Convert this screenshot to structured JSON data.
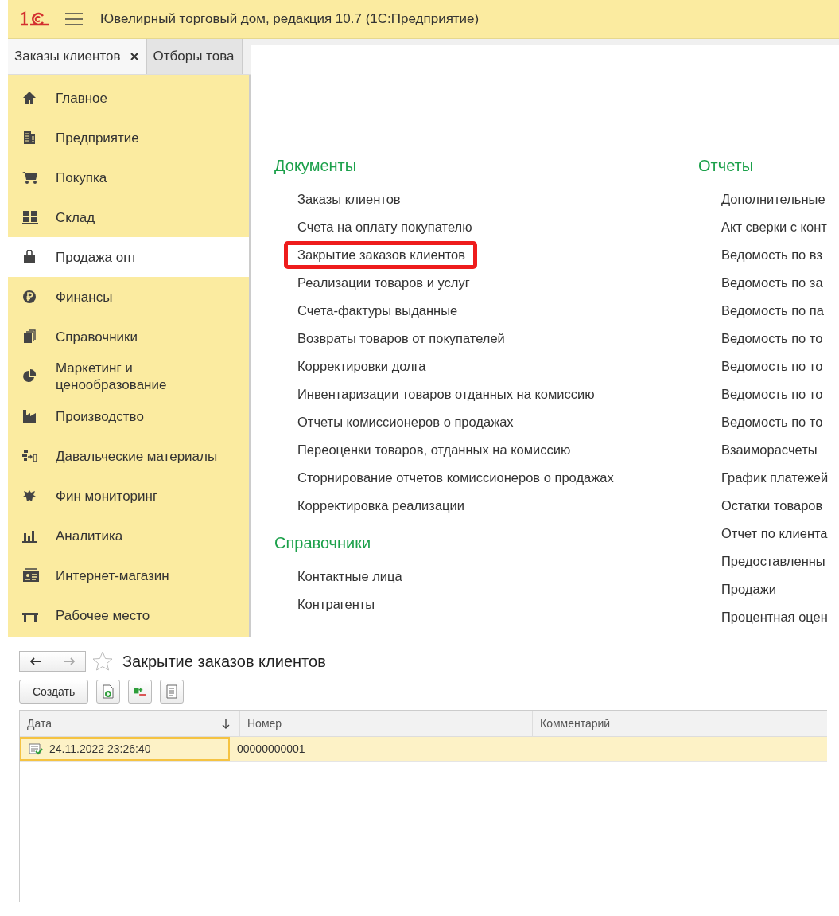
{
  "app_header": {
    "title": "Ювелирный торговый дом, редакция 10.7  (1С:Предприятие)"
  },
  "tabs": [
    {
      "label": "Заказы клиентов",
      "closable": true,
      "selected": true
    },
    {
      "label": "Отборы това",
      "closable": false,
      "selected": false
    }
  ],
  "sidebar": {
    "items": [
      {
        "label": "Главное",
        "selected": false
      },
      {
        "label": "Предприятие",
        "selected": false
      },
      {
        "label": "Покупка",
        "selected": false
      },
      {
        "label": "Склад",
        "selected": false
      },
      {
        "label": "Продажа опт",
        "selected": true
      },
      {
        "label": "Финансы",
        "selected": false
      },
      {
        "label": "Справочники",
        "selected": false
      },
      {
        "label": "Маркетинг и ценообразование",
        "selected": false
      },
      {
        "label": "Производство",
        "selected": false
      },
      {
        "label": "Давальческие материалы",
        "selected": false
      },
      {
        "label": "Фин мониторинг",
        "selected": false
      },
      {
        "label": "Аналитика",
        "selected": false
      },
      {
        "label": "Интернет-магазин",
        "selected": false
      },
      {
        "label": "Рабочее место",
        "selected": false
      }
    ]
  },
  "sections": [
    {
      "title": "Документы",
      "items": [
        {
          "label": "Заказы клиентов",
          "highlighted": false
        },
        {
          "label": "Счета на оплату покупателю",
          "highlighted": false
        },
        {
          "label": "Закрытие заказов клиентов",
          "highlighted": true
        },
        {
          "label": "Реализации товаров и услуг",
          "highlighted": false
        },
        {
          "label": "Счета-фактуры выданные",
          "highlighted": false
        },
        {
          "label": "Возвраты товаров от покупателей",
          "highlighted": false
        },
        {
          "label": "Корректировки долга",
          "highlighted": false
        },
        {
          "label": "Инвентаризации товаров отданных на комиссию",
          "highlighted": false
        },
        {
          "label": "Отчеты комиссионеров о продажах",
          "highlighted": false
        },
        {
          "label": "Переоценки товаров, отданных на комиссию",
          "highlighted": false
        },
        {
          "label": "Сторнирование отчетов комиссионеров о продажах",
          "highlighted": false
        },
        {
          "label": "Корректировка реализации",
          "highlighted": false
        }
      ]
    },
    {
      "title": "Справочники",
      "items": [
        {
          "label": "Контактные лица",
          "highlighted": false
        },
        {
          "label": "Контрагенты",
          "highlighted": false
        }
      ]
    },
    {
      "title": "Отчеты",
      "items": [
        {
          "label": "Дополнительные",
          "highlighted": false
        },
        {
          "label": "Акт сверки с конт",
          "highlighted": false
        },
        {
          "label": "Ведомость по вз",
          "highlighted": false
        },
        {
          "label": "Ведомость по за",
          "highlighted": false
        },
        {
          "label": "Ведомость по па",
          "highlighted": false
        },
        {
          "label": "Ведомость по то",
          "highlighted": false
        },
        {
          "label": "Ведомость по то",
          "highlighted": false
        },
        {
          "label": "Ведомость по то",
          "highlighted": false
        },
        {
          "label": "Ведомость по то",
          "highlighted": false
        },
        {
          "label": "Взаиморасчеты",
          "highlighted": false
        },
        {
          "label": "График платежей",
          "highlighted": false
        },
        {
          "label": "Остатки товаров",
          "highlighted": false
        },
        {
          "label": "Отчет по клиента",
          "highlighted": false
        },
        {
          "label": "Предоставленны",
          "highlighted": false
        },
        {
          "label": "Продажи",
          "highlighted": false
        },
        {
          "label": "Процентная оцен",
          "highlighted": false
        }
      ]
    }
  ],
  "list_form": {
    "title": "Закрытие заказов клиентов",
    "favorite": false,
    "create_button": "Создать",
    "table": {
      "columns": [
        {
          "label": "Дата",
          "sorted": true
        },
        {
          "label": "Номер",
          "sorted": false
        },
        {
          "label": "Комментарий",
          "sorted": false
        }
      ],
      "rows": [
        {
          "date": "24.11.2022 23:26:40",
          "number": "00000000001",
          "selected": true,
          "posted": true
        }
      ]
    }
  }
}
